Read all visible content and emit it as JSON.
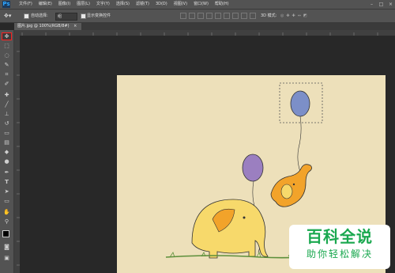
{
  "app": {
    "logo": "Ps"
  },
  "menu": [
    "文件(F)",
    "编辑(E)",
    "图像(I)",
    "图层(L)",
    "文字(Y)",
    "选择(S)",
    "滤镜(T)",
    "3D(D)",
    "视图(V)",
    "窗口(W)",
    "帮助(H)"
  ],
  "window_controls": {
    "minimize": "–",
    "maximize": "□",
    "close": "×"
  },
  "options": {
    "auto_select_label": "自动选择:",
    "auto_select_value": "组",
    "show_transform_label": "显示变换控件",
    "mode_3d_label": "3D 模式:"
  },
  "document_tab": {
    "title": "图片.jpg @ 100%(RGB/8#)",
    "close": "×"
  },
  "tools": [
    "move-tool",
    "marquee-tool",
    "lasso-tool",
    "quick-select-tool",
    "crop-tool",
    "eyedropper-tool",
    "healing-brush-tool",
    "brush-tool",
    "clone-stamp-tool",
    "history-brush-tool",
    "eraser-tool",
    "gradient-tool",
    "blur-tool",
    "dodge-tool",
    "pen-tool",
    "type-tool",
    "path-select-tool",
    "rectangle-tool",
    "hand-tool",
    "zoom-tool",
    "color-swatches",
    "quick-mask-mode",
    "screen-mode"
  ],
  "tool_glyphs": [
    "✥",
    "⬚",
    "◌",
    "✎",
    "⌗",
    "✐",
    "✚",
    "╱",
    "⊥",
    "↺",
    "▭",
    "▤",
    "◆",
    "●",
    "✒",
    "T",
    "➤",
    "▭",
    "✋",
    "⚲",
    "■",
    "◙",
    "▣"
  ],
  "colors": {
    "canvas": "#ede0ba",
    "balloon_blue": "#7c8fc8",
    "balloon_purple": "#9b7fc0",
    "elephant_orange": "#f2a32a",
    "elephant_yellow": "#f7d96b",
    "highlight": "#ff2020"
  },
  "watermark": {
    "line1": "百科全说",
    "line2": "助你轻松解决"
  }
}
